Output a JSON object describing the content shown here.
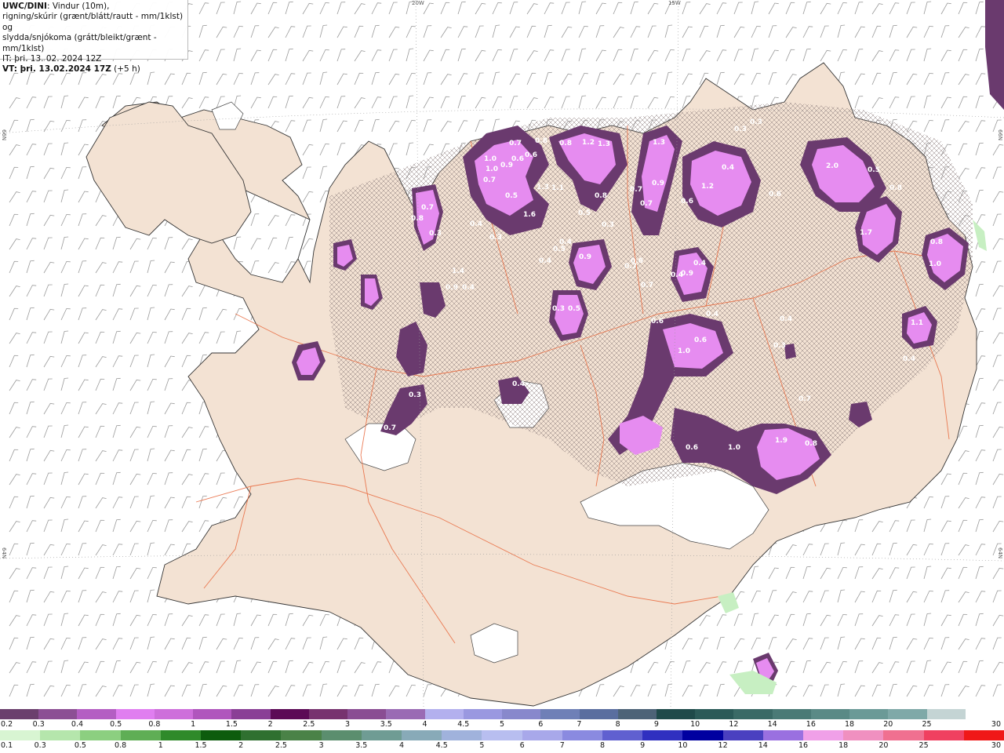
{
  "info": {
    "line1_bold": "UWC/DINI",
    "line1_rest": ": Vindur (10m),",
    "line2": "rigning/skúrir (grænt/blátt/rautt - mm/1klst) og",
    "line3": "slydda/snjókoma (grátt/bleikt/grænt - mm/1klst)",
    "line4": "IT: þri. 13. 02. 2024 12Z",
    "line5_bold": "VT: þri. 13.02.2024 17Z",
    "line5_rest": " (+5 h)"
  },
  "coords": {
    "top_20w": "20W",
    "top_15w": "15W",
    "left_66n": "66N",
    "left_64n": "64N",
    "right_66n": "66N",
    "right_64n": "64N"
  },
  "colors": {
    "sea": "#ffffff",
    "land": "#f3e2d3",
    "roads": "#e8663a",
    "coast": "#222222",
    "snow_purple_dark": "#6a3a6e",
    "snow_purple_mid": "#a65ab3",
    "snow_pink": "#e68cf0",
    "rain_green": "#c7efc2"
  },
  "precip_labels": [
    "0.7",
    "1.0",
    "1.0",
    "0.6",
    "0.6",
    "0.7",
    "0.9",
    "0.8",
    "0.8",
    "1.2",
    "1.3",
    "1.3",
    "0.3",
    "0.3",
    "2.0",
    "0.5",
    "0.7",
    "0.9",
    "0.4",
    "0.6",
    "0.5",
    "1.6",
    "1.3",
    "1.1",
    "0.8",
    "0.7",
    "0.8",
    "0.3",
    "0.3",
    "1.2",
    "0.6",
    "0.8",
    "0.7",
    "1.7",
    "0.8",
    "1.0",
    "0.5",
    "0.3",
    "0.4",
    "0.4",
    "0.5",
    "0.9",
    "0.4",
    "0.7",
    "0.6",
    "1.4",
    "0.9",
    "0.4",
    "0.3",
    "0.5",
    "0.6",
    "0.9",
    "0.4",
    "0.4",
    "0.6",
    "1.0",
    "0.4",
    "1.1",
    "0.3",
    "0.4",
    "0.4",
    "0.3",
    "0.7",
    "0.7",
    "1.9",
    "0.8",
    "0.7",
    "0.6",
    "1.0",
    "0.4"
  ],
  "legend_snow": {
    "labels": [
      "0.2",
      "0.3",
      "0.4",
      "0.5",
      "0.8",
      "1",
      "1.5",
      "2",
      "2.5",
      "3",
      "3.5",
      "4",
      "4.5",
      "5",
      "6",
      "7",
      "8",
      "9",
      "10",
      "12",
      "14",
      "16",
      "18",
      "20",
      "25",
      "30"
    ],
    "colors": [
      "#6b3f6d",
      "#8c4f94",
      "#b45ec3",
      "#e07ef0",
      "#ce6fdb",
      "#b056bd",
      "#8a3f96",
      "#5c0a56",
      "#77336f",
      "#8a4d93",
      "#9a6bb4",
      "#b3b0ee",
      "#9a98e0",
      "#8888cc",
      "#6f80b7",
      "#5a6e9f",
      "#4d6377",
      "#1f4a4a",
      "#2b5a58",
      "#3a6a66",
      "#4a7a76",
      "#5a8a86",
      "#6b9a97",
      "#7fa9a8",
      "#c4d4d4",
      "#ffffff"
    ]
  },
  "legend_rain": {
    "labels": [
      "0.1",
      "0.3",
      "0.5",
      "0.8",
      "1",
      "1.5",
      "2",
      "2.5",
      "3",
      "3.5",
      "4",
      "4.5",
      "5",
      "6",
      "7",
      "8",
      "9",
      "10",
      "12",
      "14",
      "16",
      "18",
      "20",
      "25",
      "30"
    ],
    "colors": [
      "#d8f5d2",
      "#b5e6ac",
      "#8ccf80",
      "#5fae55",
      "#2f8a2a",
      "#0d5c0d",
      "#2f7030",
      "#4a8247",
      "#5b8e6e",
      "#6f9c94",
      "#88aab8",
      "#a0b2dc",
      "#b8bef0",
      "#a8a8ea",
      "#8a8ae0",
      "#6060d0",
      "#3030c0",
      "#0000a0",
      "#4a40c0",
      "#9a70e0",
      "#f0a0e8",
      "#f090c0",
      "#f07090",
      "#f04060",
      "#f01818"
    ]
  }
}
